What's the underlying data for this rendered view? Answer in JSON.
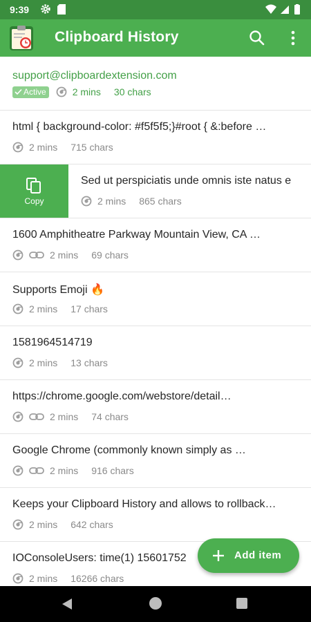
{
  "status_bar": {
    "time": "9:39"
  },
  "app_bar": {
    "title": "Clipboard History"
  },
  "items": [
    {
      "text": "support@clipboardextension.com",
      "badge": "Active",
      "time": "2 mins",
      "chars": "30 chars",
      "link": false,
      "active": true
    },
    {
      "text": "html { background-color: #f5f5f5;}#root { &:before …",
      "time": "2 mins",
      "chars": "715 chars",
      "link": false
    },
    {
      "text": "Sed ut perspiciatis unde omnis iste natus e",
      "time": "2 mins",
      "chars": "865 chars",
      "link": false,
      "swiped": true
    },
    {
      "text": "1600 Amphitheatre Parkway Mountain View, CA …",
      "time": "2 mins",
      "chars": "69 chars",
      "link": true
    },
    {
      "text": "Supports Emoji 🔥",
      "time": "2 mins",
      "chars": "17 chars",
      "link": false
    },
    {
      "text": "1581964514719",
      "time": "2 mins",
      "chars": "13 chars",
      "link": false
    },
    {
      "text": "https://chrome.google.com/webstore/detail…",
      "time": "2 mins",
      "chars": "74 chars",
      "link": true
    },
    {
      "text": "Google Chrome (commonly known simply as …",
      "time": "2 mins",
      "chars": "916 chars",
      "link": true
    },
    {
      "text": "Keeps your Clipboard History and allows to rollback…",
      "time": "2 mins",
      "chars": "642 chars",
      "link": false
    },
    {
      "text": "IOConsoleUsers: time(1) 15601752",
      "time": "2 mins",
      "chars": "16266 chars",
      "link": false
    }
  ],
  "copy_action": {
    "label": "Copy"
  },
  "fab": {
    "label": "Add item"
  },
  "colors": {
    "primary": "#4caf50",
    "status_bar": "#3a8e3e",
    "active_text": "#43a047"
  }
}
